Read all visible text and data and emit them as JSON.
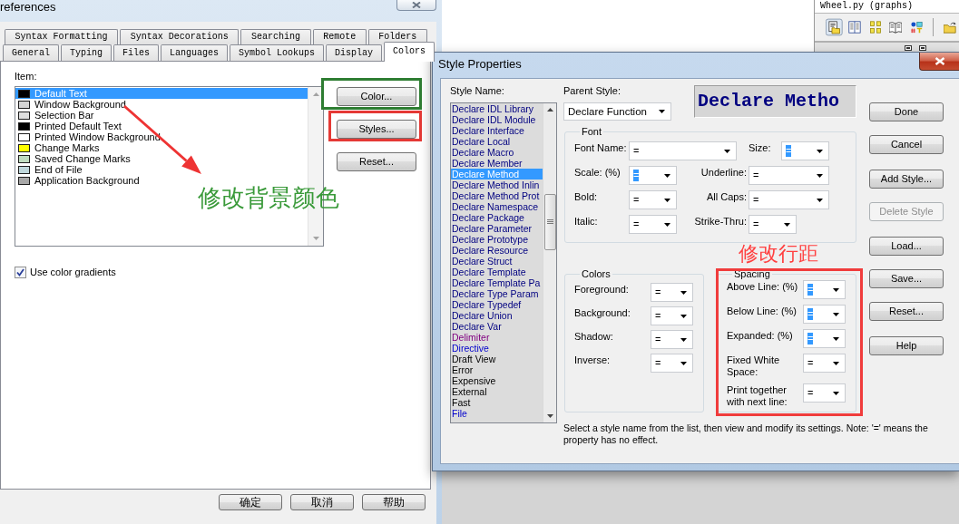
{
  "preferences": {
    "title": "references",
    "tab_rows": [
      {
        "tabs": [
          {
            "label": "Syntax Formatting",
            "selected": false
          },
          {
            "label": "Syntax Decorations",
            "selected": false
          },
          {
            "label": "Searching",
            "selected": false
          },
          {
            "label": "Remote",
            "selected": false
          },
          {
            "label": "Folders",
            "selected": false
          }
        ]
      },
      {
        "tabs": [
          {
            "label": "General",
            "selected": false
          },
          {
            "label": "Typing",
            "selected": false
          },
          {
            "label": "Files",
            "selected": false
          },
          {
            "label": "Languages",
            "selected": false
          },
          {
            "label": "Symbol Lookups",
            "selected": false
          },
          {
            "label": "Display",
            "selected": false
          },
          {
            "label": "Colors",
            "selected": true
          }
        ]
      }
    ],
    "item_label": "Item:",
    "items": [
      {
        "label": "Default Text",
        "color": "#000000",
        "selected": true
      },
      {
        "label": "Window Background",
        "color": "#d4d4d4",
        "selected": false
      },
      {
        "label": "Selection Bar",
        "color": "#dedede",
        "selected": false
      },
      {
        "label": "Printed Default Text",
        "color": "#000000",
        "selected": false
      },
      {
        "label": "Printed Window Background",
        "color": "#ffffff",
        "selected": false
      },
      {
        "label": "Change Marks",
        "color": "#ffff00",
        "selected": false
      },
      {
        "label": "Saved Change Marks",
        "color": "#c0dcc0",
        "selected": false
      },
      {
        "label": "End of File",
        "color": "#c0d8dc",
        "selected": false
      },
      {
        "label": "Application Background",
        "color": "#a8a8a8",
        "selected": false
      }
    ],
    "buttons": [
      {
        "label": "Color...",
        "color": "#2e7d32"
      },
      {
        "label": "Styles...",
        "color": "#e53935"
      },
      {
        "label": "Reset..."
      }
    ],
    "gradients": {
      "label": "Use color gradients",
      "checked": true
    },
    "annotation": {
      "text": "修改背景颜色",
      "color": "#3a9a3a"
    },
    "footer_buttons": [
      "确定",
      "取消",
      "帮助"
    ]
  },
  "background_app": {
    "file_title": "Wheel.py (graphs)",
    "toolbar": [
      {
        "selected": true
      },
      {
        "selected": false
      },
      {
        "selected": false
      },
      {
        "selected": false
      },
      {
        "selected": false
      },
      {
        "selected": false
      }
    ]
  },
  "style_properties": {
    "title": "Style Properties",
    "style_name_label": "Style Name:",
    "styles": [
      {
        "label": "Declare IDL Library",
        "color": "#000080",
        "selected": false
      },
      {
        "label": "Declare IDL Module",
        "color": "#000080",
        "selected": false
      },
      {
        "label": "Declare Interface",
        "color": "#000080",
        "selected": false
      },
      {
        "label": "Declare Local",
        "color": "#000080",
        "selected": false
      },
      {
        "label": "Declare Macro",
        "color": "#000080",
        "selected": false
      },
      {
        "label": "Declare Member",
        "color": "#000080",
        "selected": false
      },
      {
        "label": "Declare Method",
        "selected": true
      },
      {
        "label": "Declare Method Inlin",
        "color": "#000080",
        "selected": false
      },
      {
        "label": "Declare Method Prot",
        "color": "#000080",
        "selected": false
      },
      {
        "label": "Declare Namespace",
        "color": "#000080",
        "selected": false
      },
      {
        "label": "Declare Package",
        "color": "#000080",
        "selected": false
      },
      {
        "label": "Declare Parameter",
        "color": "#000080",
        "selected": false
      },
      {
        "label": "Declare Prototype",
        "color": "#000080",
        "selected": false
      },
      {
        "label": "Declare Resource",
        "color": "#000080",
        "selected": false
      },
      {
        "label": "Declare Struct",
        "color": "#000080",
        "selected": false
      },
      {
        "label": "Declare Template",
        "color": "#000080",
        "selected": false
      },
      {
        "label": "Declare Template Pa",
        "color": "#000080",
        "selected": false
      },
      {
        "label": "Declare Type Param",
        "color": "#000080",
        "selected": false
      },
      {
        "label": "Declare Typedef",
        "color": "#000080",
        "selected": false
      },
      {
        "label": "Declare Union",
        "color": "#000080",
        "selected": false
      },
      {
        "label": "Declare Var",
        "color": "#000080",
        "selected": false
      },
      {
        "label": "Delimiter",
        "color": "#800080",
        "selected": false
      },
      {
        "label": "Directive",
        "color": "#0000cc",
        "selected": false
      },
      {
        "label": "Draft View",
        "color": "#000000",
        "selected": false
      },
      {
        "label": "Error",
        "color": "#000000",
        "selected": false
      },
      {
        "label": "Expensive",
        "color": "#000000",
        "selected": false
      },
      {
        "label": "External",
        "color": "#000000",
        "selected": false
      },
      {
        "label": "Fast",
        "color": "#000000",
        "selected": false
      },
      {
        "label": "File",
        "color": "#0000cc",
        "selected": false
      }
    ],
    "parent_style": {
      "label": "Parent Style:",
      "value": "Declare Function"
    },
    "preview": "Declare Metho",
    "font": {
      "legend": "Font",
      "fields": [
        {
          "label": "Font Name:",
          "value": "=",
          "highlighted": false
        },
        {
          "label": "Size:",
          "value": "=",
          "highlighted": true
        },
        {
          "label": "Scale: (%)",
          "value": "=",
          "highlighted": true
        },
        {
          "label": "Underline:",
          "value": "=",
          "highlighted": false
        },
        {
          "label": "Bold:",
          "value": "=",
          "highlighted": false
        },
        {
          "label": "All Caps:",
          "value": "=",
          "highlighted": false
        },
        {
          "label": "Italic:",
          "value": "=",
          "highlighted": false
        },
        {
          "label": "Strike-Thru:",
          "value": "=",
          "highlighted": false
        }
      ]
    },
    "annotation": {
      "text": "修改行距",
      "color": "#ff4040"
    },
    "colors": {
      "legend": "Colors",
      "fields": [
        {
          "label": "Foreground:",
          "value": "=",
          "highlighted": false
        },
        {
          "label": "Background:",
          "value": "=",
          "highlighted": false
        },
        {
          "label": "Shadow:",
          "value": "=",
          "highlighted": false
        },
        {
          "label": "Inverse:",
          "value": "=",
          "highlighted": false
        }
      ]
    },
    "spacing": {
      "legend": "Spacing",
      "color": "#f03c3c",
      "fields": [
        {
          "label": "Above Line: (%)",
          "value": "=",
          "highlighted": true
        },
        {
          "label": "Below Line: (%)",
          "value": "=",
          "highlighted": true
        },
        {
          "label": "Expanded: (%)",
          "value": "=",
          "highlighted": true
        },
        {
          "label": "Fixed White Space:",
          "value": "=",
          "highlighted": false
        },
        {
          "label": "Print together with next line:",
          "value": "=",
          "highlighted": false
        }
      ]
    },
    "button_groups": [
      {
        "buttons": [
          {
            "label": "Done",
            "disabled": false
          },
          {
            "label": "Cancel",
            "disabled": false
          }
        ]
      },
      {
        "buttons": [
          {
            "label": "Add Style...",
            "disabled": false
          },
          {
            "label": "Delete Style",
            "disabled": true
          }
        ]
      },
      {
        "buttons": [
          {
            "label": "Load...",
            "disabled": false
          },
          {
            "label": "Save...",
            "disabled": false
          },
          {
            "label": "Reset...",
            "disabled": false
          }
        ]
      },
      {
        "buttons": [
          {
            "label": "Help",
            "disabled": false
          }
        ]
      }
    ],
    "note": "Select a style name from the list, then view and modify its settings. Note: '=' means the property has no effect."
  }
}
